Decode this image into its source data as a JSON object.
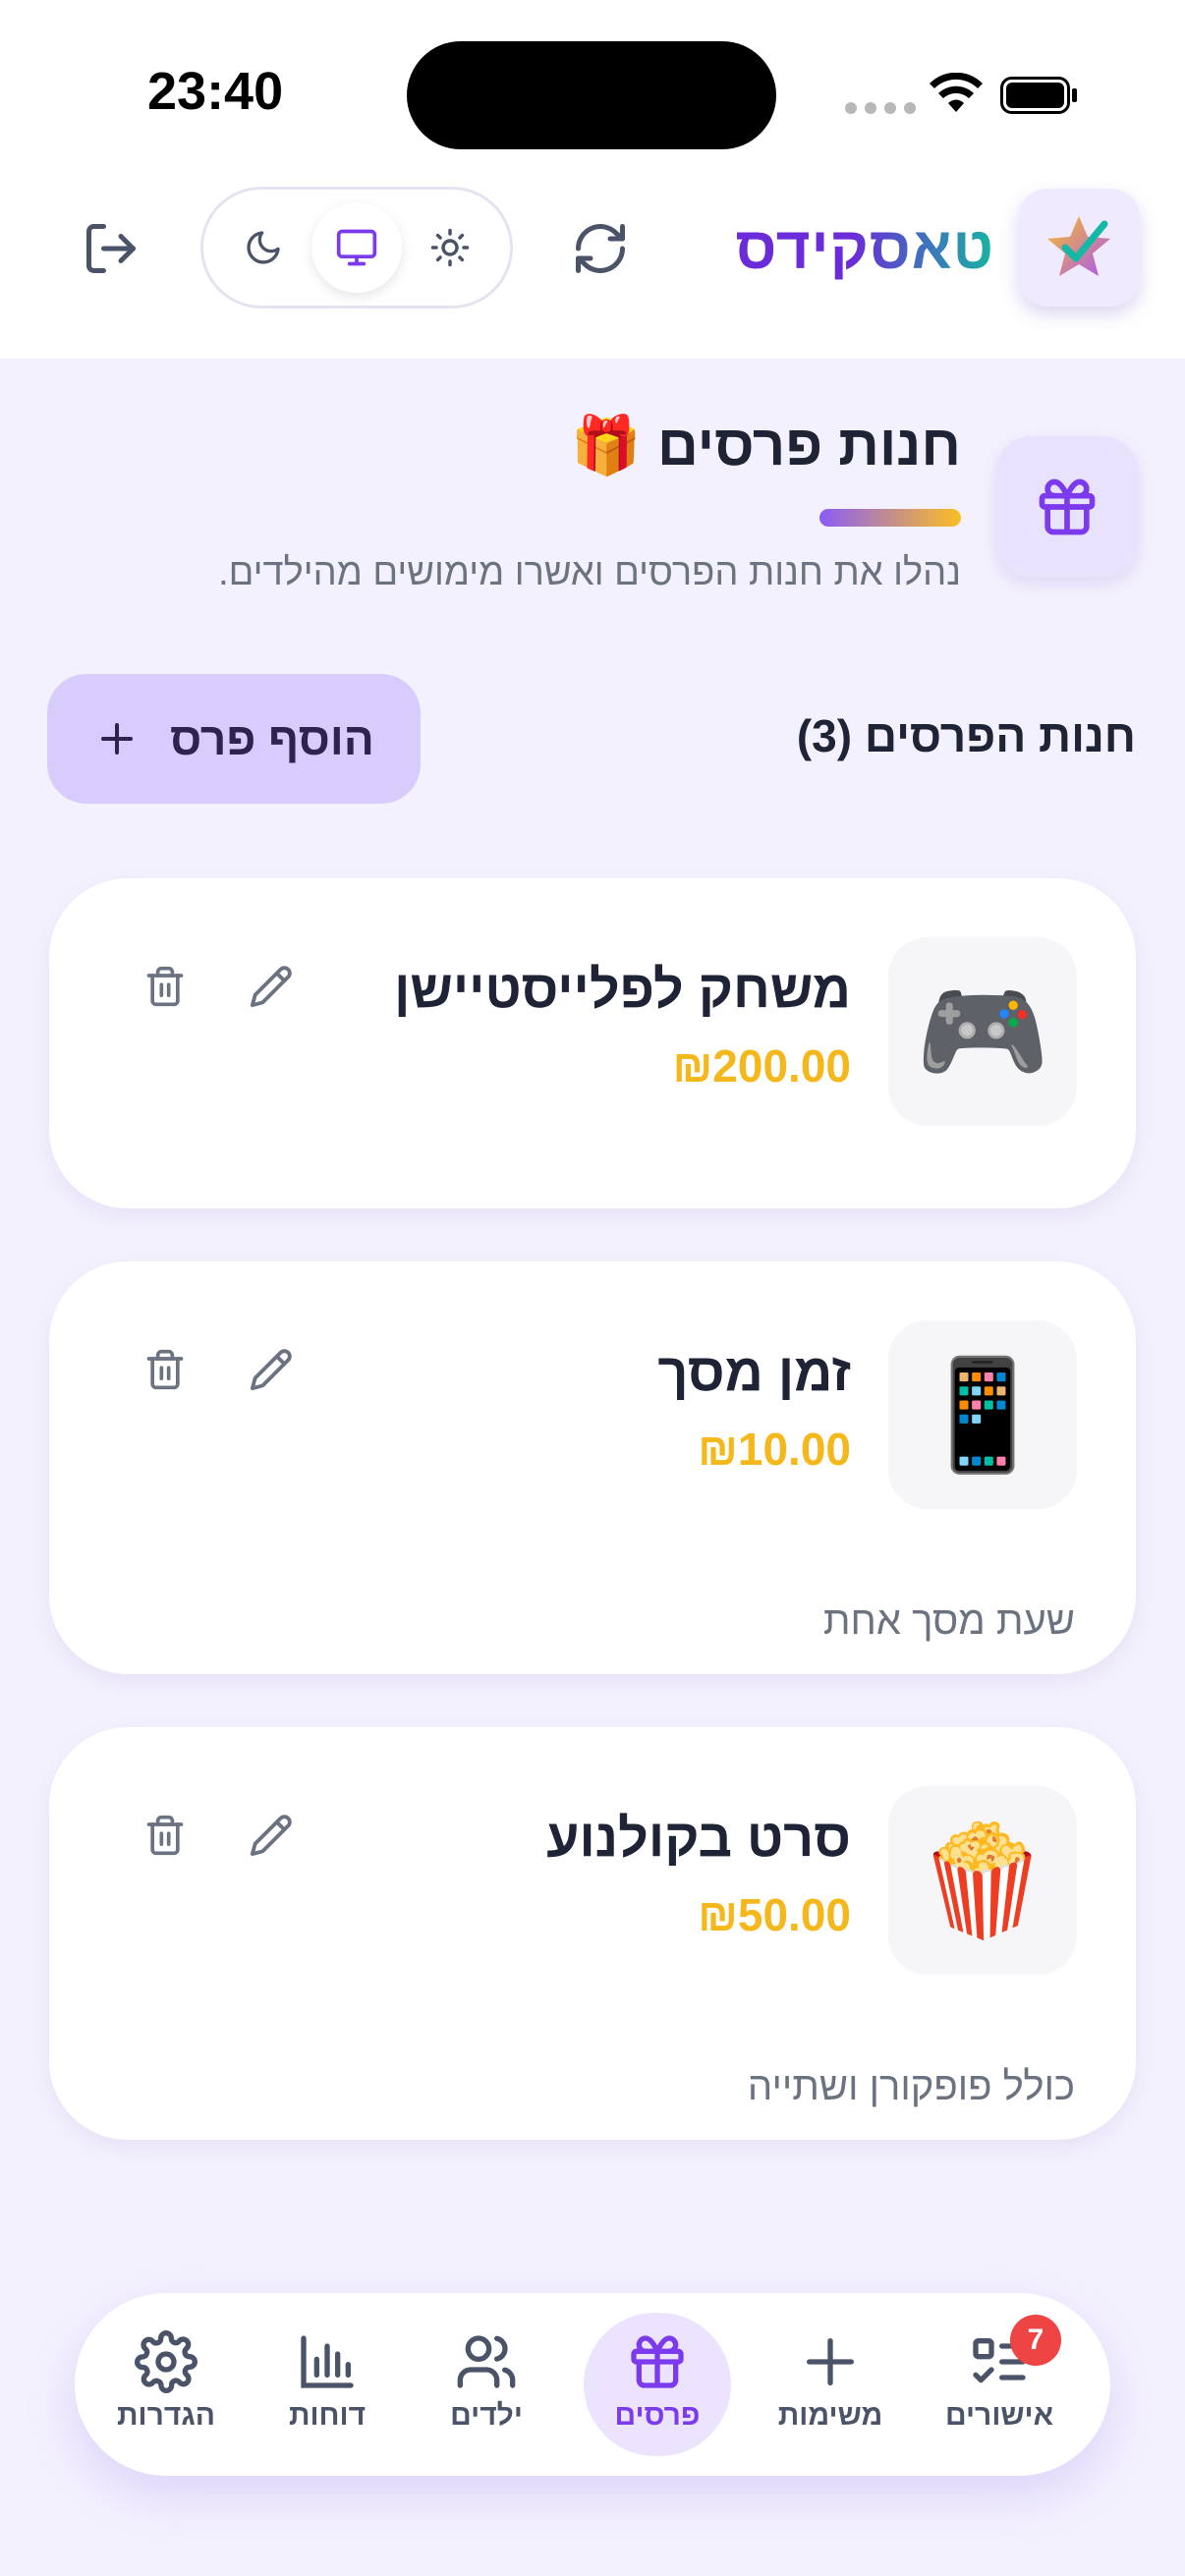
{
  "status_bar": {
    "time": "23:40"
  },
  "header": {
    "app_name": "טאסקידס",
    "logo_icon": "star-check-icon",
    "refresh_icon": "refresh-icon",
    "theme_options": [
      "sun-icon",
      "monitor-icon",
      "moon-icon"
    ],
    "theme_selected": "monitor-icon",
    "logout_icon": "logout-icon"
  },
  "page": {
    "title": "חנות פרסים 🎁",
    "subtitle": "נהלו את חנות הפרסים ואשרו מימושים מהילדים.",
    "icon": "gift-icon"
  },
  "section": {
    "title": "חנות הפרסים (3)",
    "add_button_label": "הוסף פרס"
  },
  "rewards": [
    {
      "emoji": "🎮",
      "name": "משחק לפלייסטיישן",
      "price": "₪200.00",
      "description": ""
    },
    {
      "emoji": "📱",
      "name": "זמן מסך",
      "price": "₪10.00",
      "description": "שעת מסך אחת"
    },
    {
      "emoji": "🍿",
      "name": "סרט בקולנוע",
      "price": "₪50.00",
      "description": "כולל פופקורן ושתייה"
    }
  ],
  "nav": {
    "items": [
      {
        "label": "אישורים",
        "icon": "approvals-icon",
        "badge": "7"
      },
      {
        "label": "משימות",
        "icon": "plus-icon"
      },
      {
        "label": "פרסים",
        "icon": "gift-icon",
        "active": true
      },
      {
        "label": "ילדים",
        "icon": "users-icon"
      },
      {
        "label": "דוחות",
        "icon": "bar-chart-icon"
      },
      {
        "label": "הגדרות",
        "icon": "gear-icon"
      }
    ]
  },
  "colors": {
    "accent": "#7c3aed",
    "price": "#f5b81c",
    "badge": "#ef4444",
    "background": "#f4f1fe"
  }
}
